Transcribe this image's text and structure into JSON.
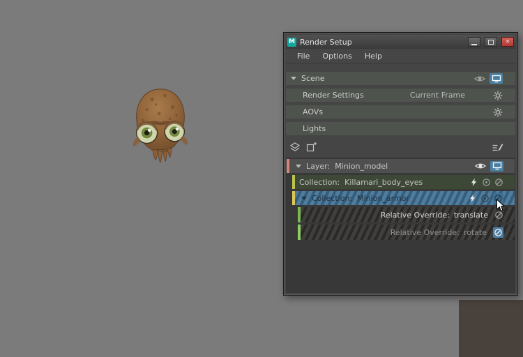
{
  "window": {
    "title": "Render Setup",
    "app_icon_letter": "M",
    "close_glyph": "✕",
    "menu": {
      "file": "File",
      "options": "Options",
      "help": "Help"
    },
    "sections": {
      "scene_label": "Scene",
      "render_settings_label": "Render Settings",
      "render_settings_value": "Current Frame",
      "aovs_label": "AOVs",
      "lights_label": "Lights"
    },
    "list": {
      "layer_prefix": "Layer:",
      "layer_name": "Minion_model",
      "collection1_prefix": "Collection:",
      "collection1_name": "Killamari_body_eyes",
      "collection2_prefix": "Collection:",
      "collection2_name": "Minion_armor",
      "override1_prefix": "Relative Override:",
      "override1_name": "translate",
      "override2_prefix": "Relative Override:",
      "override2_name": "rotate"
    }
  },
  "colors": {
    "viewport": "#7b7b7b",
    "background_corner": "#49413c",
    "selection_blue": "#4e7da0",
    "highlight_blue": "#4a7fa3",
    "layer_stripe": "#d28878",
    "collection1_stripe": "#b9c24c",
    "collection1_bg": "#3e4837",
    "collection2_stripe": "#d8c852",
    "override_translate_stripe": "#7cbb4f",
    "override_rotate_stripe": "#8ccf63"
  }
}
